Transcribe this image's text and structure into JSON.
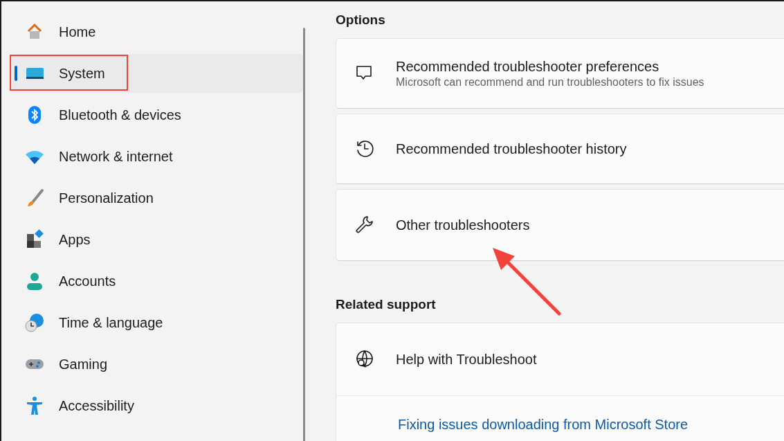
{
  "sidebar": {
    "items": [
      {
        "label": "Home",
        "selected": false
      },
      {
        "label": "System",
        "selected": true
      },
      {
        "label": "Bluetooth & devices",
        "selected": false
      },
      {
        "label": "Network & internet",
        "selected": false
      },
      {
        "label": "Personalization",
        "selected": false
      },
      {
        "label": "Apps",
        "selected": false
      },
      {
        "label": "Accounts",
        "selected": false
      },
      {
        "label": "Time & language",
        "selected": false
      },
      {
        "label": "Gaming",
        "selected": false
      },
      {
        "label": "Accessibility",
        "selected": false
      }
    ]
  },
  "options": {
    "title": "Options",
    "cards": [
      {
        "title": "Recommended troubleshooter preferences",
        "subtitle": "Microsoft can recommend and run troubleshooters to fix issues"
      },
      {
        "title": "Recommended troubleshooter history"
      },
      {
        "title": "Other troubleshooters"
      }
    ]
  },
  "related_support": {
    "title": "Related support",
    "header": "Help with Troubleshoot",
    "links": [
      "Fixing issues downloading from Microsoft Store"
    ]
  }
}
